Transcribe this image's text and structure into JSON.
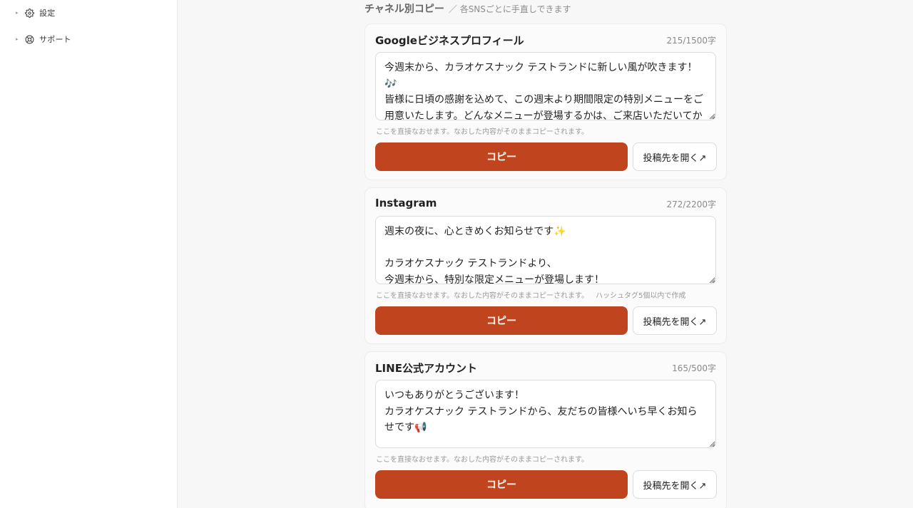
{
  "sidebar": {
    "items": [
      {
        "label": "設定",
        "icon": "gear-icon"
      },
      {
        "label": "サポート",
        "icon": "lifebuoy-icon"
      }
    ]
  },
  "section": {
    "title": "チャネル別コピー",
    "subtitle": "／ 各SNSごとに手直しできます"
  },
  "channels": [
    {
      "title": "Googleビジネスプロフィール",
      "count": "215/1500字",
      "text": "今週末から、カラオケスナック テストランドに新しい風が吹きます！🎶\n皆様に日頃の感謝を込めて、この週末より期間限定の特別メニューをご用意いたします。どんなメニューが登場するかは、ご来店いただいてからのお楽しみです。",
      "hint": "ここを直接なおせます。なおした内容がそのままコピーされます。",
      "hint_extra": "",
      "copy_label": "コピー",
      "open_label": "投稿先を開く↗"
    },
    {
      "title": "Instagram",
      "count": "272/2200字",
      "text": "週末の夜に、心ときめくお知らせです✨\n\nカラオケスナック テストランドより、\n今週末から、特別な限定メニューが登場します！",
      "hint": "ここを直接なおせます。なおした内容がそのままコピーされます。",
      "hint_extra": "ハッシュタグ5個以内で作成",
      "copy_label": "コピー",
      "open_label": "投稿先を開く↗"
    },
    {
      "title": "LINE公式アカウント",
      "count": "165/500字",
      "text": "いつもありがとうございます！\nカラオケスナック テストランドから、友だちの皆様へいち早くお知らせです📢",
      "hint": "ここを直接なおせます。なおした内容がそのままコピーされます。",
      "hint_extra": "",
      "copy_label": "コピー",
      "open_label": "投稿先を開く↗"
    }
  ],
  "colors": {
    "accent": "#c0441e",
    "sidebar_bg": "#ffffff",
    "page_bg": "#f7f7f8"
  }
}
